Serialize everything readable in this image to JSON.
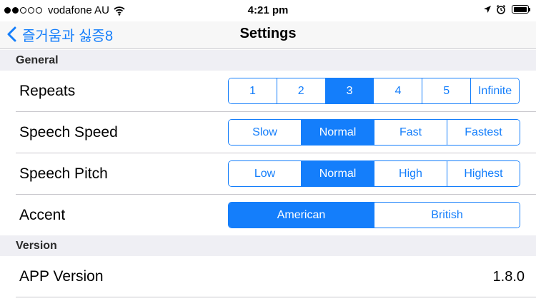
{
  "status_bar": {
    "carrier": "vodafone AU",
    "signal_bars_filled": 2,
    "signal_bars_total": 5,
    "time": "4:21 pm",
    "icons": [
      "wifi-icon",
      "location-arrow-icon",
      "alarm-icon",
      "battery-icon"
    ],
    "battery_level": 0.95
  },
  "nav": {
    "back_label": "즐거움과 싫증8",
    "title": "Settings"
  },
  "sections": {
    "general": "General",
    "version": "Version"
  },
  "rows": {
    "repeats": {
      "label": "Repeats",
      "options": [
        "1",
        "2",
        "3",
        "4",
        "5",
        "Infinite"
      ],
      "selected_index": 2
    },
    "speech_speed": {
      "label": "Speech Speed",
      "options": [
        "Slow",
        "Normal",
        "Fast",
        "Fastest"
      ],
      "selected_index": 1
    },
    "speech_pitch": {
      "label": "Speech Pitch",
      "options": [
        "Low",
        "Normal",
        "High",
        "Highest"
      ],
      "selected_index": 1
    },
    "accent": {
      "label": "Accent",
      "options": [
        "American",
        "British"
      ],
      "selected_index": 0
    },
    "app_version": {
      "label": "APP Version",
      "value": "1.8.0"
    }
  },
  "colors": {
    "accent": "#147efb",
    "group_background": "#efeff4",
    "separator": "#c8c7cc"
  }
}
